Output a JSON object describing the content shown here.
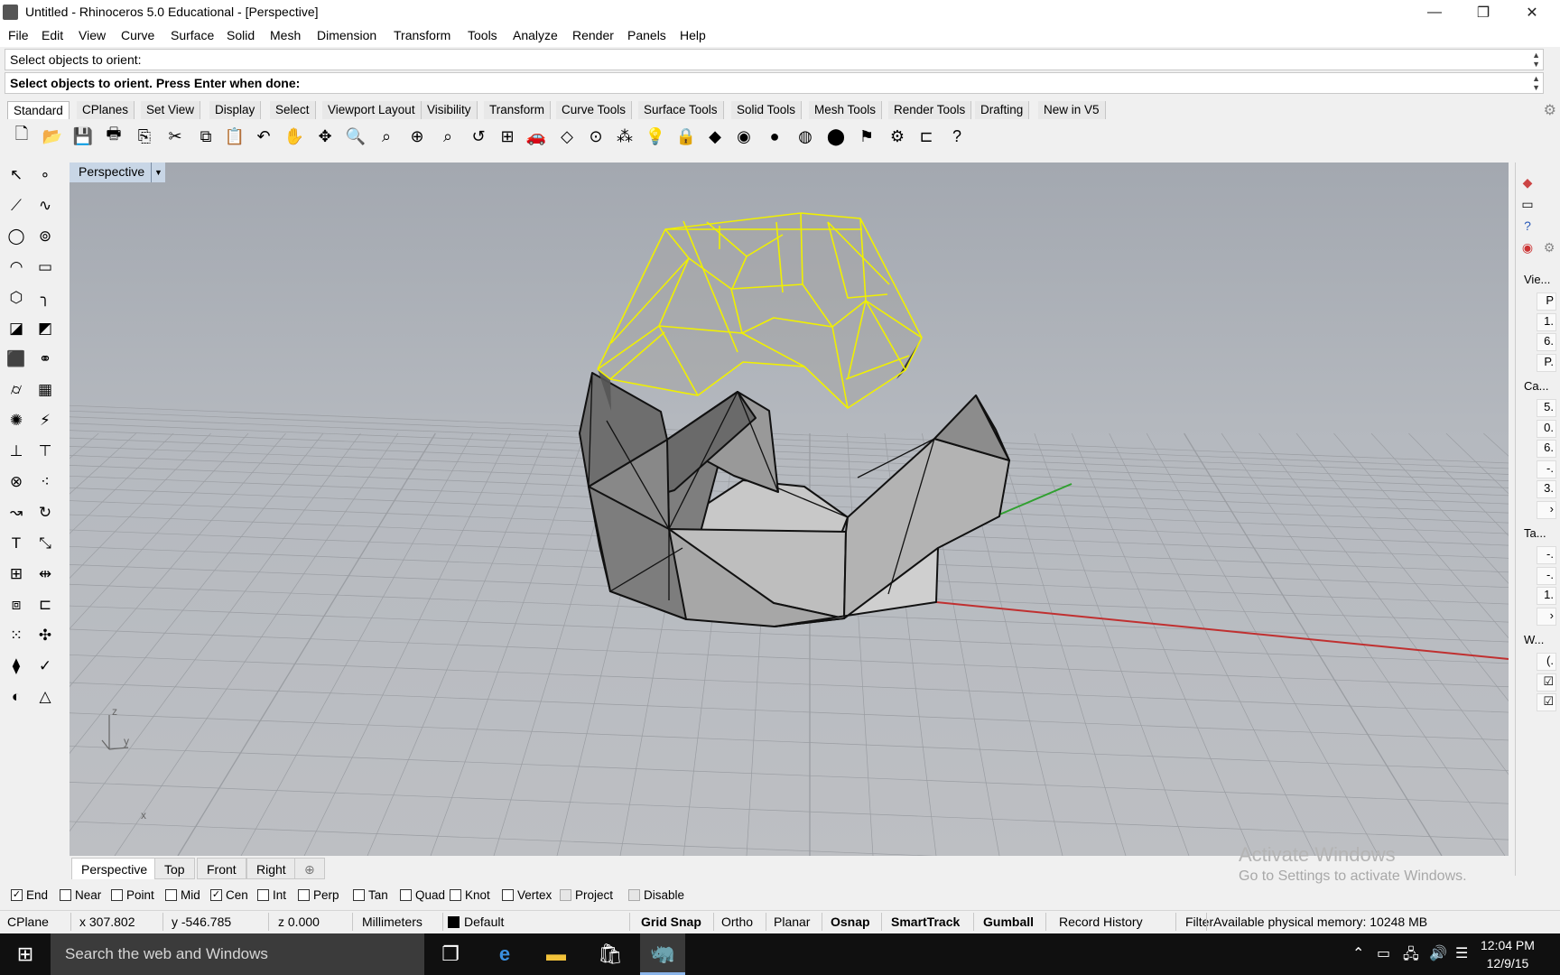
{
  "window": {
    "title": "Untitled - Rhinoceros 5.0 Educational - [Perspective]",
    "controls": {
      "minimize": "—",
      "restore": "❐",
      "close": "✕"
    }
  },
  "menu": [
    "File",
    "Edit",
    "View",
    "Curve",
    "Surface",
    "Solid",
    "Mesh",
    "Dimension",
    "Transform",
    "Tools",
    "Analyze",
    "Render",
    "Panels",
    "Help"
  ],
  "command": {
    "history": "Select objects to orient:",
    "prompt": "Select objects to orient. Press Enter when done:"
  },
  "toolbar_tabs": [
    "Standard",
    "CPlanes",
    "Set View",
    "Display",
    "Select",
    "Viewport Layout",
    "Visibility",
    "Transform",
    "Curve Tools",
    "Surface Tools",
    "Solid Tools",
    "Mesh Tools",
    "Render Tools",
    "Drafting",
    "New in V5"
  ],
  "toolbar_icons": [
    {
      "name": "new-icon",
      "glyph": "🗋"
    },
    {
      "name": "open-icon",
      "glyph": "📂"
    },
    {
      "name": "save-icon",
      "glyph": "💾"
    },
    {
      "name": "print-icon",
      "glyph": "🖶"
    },
    {
      "name": "export-icon",
      "glyph": "⎘"
    },
    {
      "name": "cut-icon",
      "glyph": "✂"
    },
    {
      "name": "copy-icon",
      "glyph": "⧉"
    },
    {
      "name": "paste-icon",
      "glyph": "📋"
    },
    {
      "name": "undo-icon",
      "glyph": "↶"
    },
    {
      "name": "pan-icon",
      "glyph": "✋"
    },
    {
      "name": "rotate-view-icon",
      "glyph": "✥"
    },
    {
      "name": "zoom-icon",
      "glyph": "🔍"
    },
    {
      "name": "zoom-window-icon",
      "glyph": "⌕"
    },
    {
      "name": "zoom-extents-icon",
      "glyph": "⊕"
    },
    {
      "name": "zoom-selected-icon",
      "glyph": "⌕"
    },
    {
      "name": "undo-view-icon",
      "glyph": "↺"
    },
    {
      "name": "four-viewports-icon",
      "glyph": "⊞"
    },
    {
      "name": "car-icon",
      "glyph": "🚗"
    },
    {
      "name": "cplane-icon",
      "glyph": "◇"
    },
    {
      "name": "osnap-icon",
      "glyph": "⊙"
    },
    {
      "name": "select-points-icon",
      "glyph": "⁂"
    },
    {
      "name": "light-icon",
      "glyph": "💡"
    },
    {
      "name": "lock-icon",
      "glyph": "🔒"
    },
    {
      "name": "layer-icon",
      "glyph": "◆"
    },
    {
      "name": "color-wheel-icon",
      "glyph": "◉"
    },
    {
      "name": "shade-icon",
      "glyph": "●"
    },
    {
      "name": "render-preview-icon",
      "glyph": "◍"
    },
    {
      "name": "render-icon",
      "glyph": "⬤"
    },
    {
      "name": "filter-icon",
      "glyph": "⚑"
    },
    {
      "name": "options-icon",
      "glyph": "⚙"
    },
    {
      "name": "dimension-icon",
      "glyph": "⊏"
    },
    {
      "name": "help-icon",
      "glyph": "?"
    }
  ],
  "left_tools": [
    {
      "name": "select-arrow-icon",
      "glyph": "↖"
    },
    {
      "name": "point-icon",
      "glyph": "∘"
    },
    {
      "name": "polyline-icon",
      "glyph": "⟋"
    },
    {
      "name": "curve-icon",
      "glyph": "∿"
    },
    {
      "name": "circle-icon",
      "glyph": "◯"
    },
    {
      "name": "ellipse-icon",
      "glyph": "⊚"
    },
    {
      "name": "arc-icon",
      "glyph": "◠"
    },
    {
      "name": "rectangle-icon",
      "glyph": "▭"
    },
    {
      "name": "polygon-icon",
      "glyph": "⬡"
    },
    {
      "name": "fillet-curve-icon",
      "glyph": "╮"
    },
    {
      "name": "surface-icon",
      "glyph": "◪"
    },
    {
      "name": "extrude-surface-icon",
      "glyph": "◩"
    },
    {
      "name": "box-icon",
      "glyph": "⬛"
    },
    {
      "name": "sphere-union-icon",
      "glyph": "⚭"
    },
    {
      "name": "cylinder-icon",
      "glyph": "⌭"
    },
    {
      "name": "mesh-icon",
      "glyph": "▦"
    },
    {
      "name": "explode-icon",
      "glyph": "✺"
    },
    {
      "name": "split-icon",
      "glyph": "⚡"
    },
    {
      "name": "trim-icon",
      "glyph": "⊥"
    },
    {
      "name": "extend-icon",
      "glyph": "⊤"
    },
    {
      "name": "boolean-icon",
      "glyph": "⊗"
    },
    {
      "name": "join-icon",
      "glyph": "⁖"
    },
    {
      "name": "move-icon",
      "glyph": "↝"
    },
    {
      "name": "rotate-icon",
      "glyph": "↻"
    },
    {
      "name": "text-icon",
      "glyph": "T"
    },
    {
      "name": "scale-icon",
      "glyph": "⤡"
    },
    {
      "name": "array-icon",
      "glyph": "⊞"
    },
    {
      "name": "mirror-icon",
      "glyph": "⇹"
    },
    {
      "name": "block-icon",
      "glyph": "⧈"
    },
    {
      "name": "dimension-tool-icon",
      "glyph": "⊏"
    },
    {
      "name": "grid-array-icon",
      "glyph": "⁙"
    },
    {
      "name": "gumball-icon",
      "glyph": "✣"
    },
    {
      "name": "analyze-icon",
      "glyph": "⧫"
    },
    {
      "name": "check-icon",
      "glyph": "✓"
    },
    {
      "name": "render-mesh-icon",
      "glyph": "◐"
    },
    {
      "name": "drafting-icon",
      "glyph": "△"
    }
  ],
  "viewport": {
    "title": "Perspective",
    "axis_labels": {
      "z": "z",
      "y": "y",
      "x": "x"
    },
    "tabs": [
      "Perspective",
      "Top",
      "Front",
      "Right",
      "⊕"
    ]
  },
  "right_panel": {
    "sections": [
      {
        "label": "Vie...",
        "values": [
          "P",
          "1.",
          "6.",
          "P."
        ]
      },
      {
        "label": "Ca...",
        "values": [
          "5.",
          "0.",
          "6.",
          "-.",
          "3.",
          "›"
        ]
      },
      {
        "label": "Ta...",
        "values": [
          "-.",
          "-.",
          "1.",
          "›"
        ]
      },
      {
        "label": "W...",
        "values": [
          "(.",
          "☑",
          "☑"
        ]
      }
    ]
  },
  "osnaps": [
    {
      "label": "End",
      "checked": true
    },
    {
      "label": "Near",
      "checked": false
    },
    {
      "label": "Point",
      "checked": false
    },
    {
      "label": "Mid",
      "checked": false
    },
    {
      "label": "Cen",
      "checked": true
    },
    {
      "label": "Int",
      "checked": false
    },
    {
      "label": "Perp",
      "checked": false
    },
    {
      "label": "Tan",
      "checked": false
    },
    {
      "label": "Quad",
      "checked": false
    },
    {
      "label": "Knot",
      "checked": false
    },
    {
      "label": "Vertex",
      "checked": false
    },
    {
      "label": "Project",
      "checked": false
    },
    {
      "label": "Disable",
      "checked": false
    }
  ],
  "status": {
    "cplane": "CPlane",
    "x": "x 307.802",
    "y": "y -546.785",
    "z": "z 0.000",
    "units": "Millimeters",
    "layer": "Default",
    "grid_snap": "Grid Snap",
    "ortho": "Ortho",
    "planar": "Planar",
    "osnap": "Osnap",
    "smarttrack": "SmartTrack",
    "gumball": "Gumball",
    "record_history": "Record History",
    "filter": "Filter",
    "memory": "Available physical memory: 10248 MB"
  },
  "watermark": {
    "line1": "Activate Windows",
    "line2": "Go to Settings to activate Windows."
  },
  "taskbar": {
    "search_placeholder": "Search the web and Windows",
    "time": "12:04 PM",
    "date": "12/9/15"
  },
  "colors": {
    "selection": "#f0f000",
    "x_axis": "#c03030",
    "y_axis": "#30a030"
  }
}
